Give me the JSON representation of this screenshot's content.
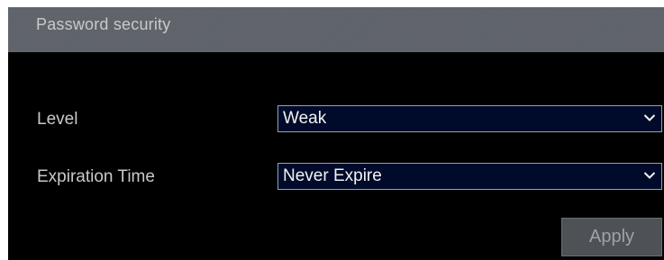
{
  "section": {
    "title": "Password security"
  },
  "fields": {
    "level": {
      "label": "Level",
      "value": "Weak",
      "icon": "chevron-down-icon"
    },
    "expiration": {
      "label": "Expiration Time",
      "value": "Never Expire",
      "icon": "chevron-down-icon"
    }
  },
  "actions": {
    "apply_label": "Apply"
  },
  "colors": {
    "background": "#000000",
    "title_bar": "#5e6369",
    "select_background": "#000a2a",
    "button_background": "#4e5257"
  }
}
